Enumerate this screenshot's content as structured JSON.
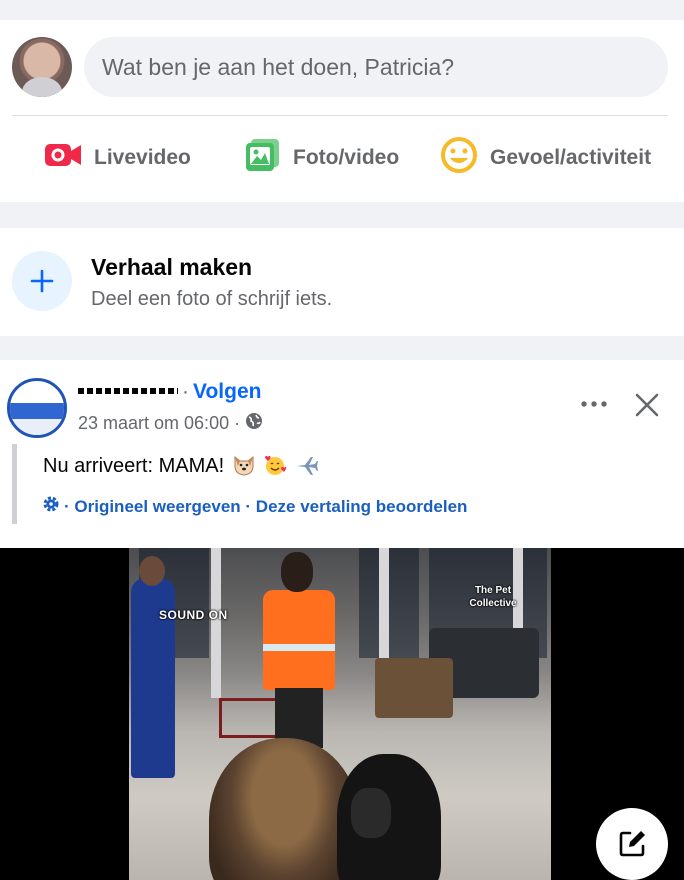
{
  "composer": {
    "placeholder": "Wat ben je aan het doen, Patricia?",
    "actions": [
      {
        "label": "Livevideo",
        "icon": "live-video-icon",
        "color": "#f02849"
      },
      {
        "label": "Foto/video",
        "icon": "photo-icon",
        "color": "#45bd62"
      },
      {
        "label": "Gevoel/activiteit",
        "icon": "feeling-icon",
        "color": "#f7b928"
      }
    ]
  },
  "story": {
    "title": "Verhaal maken",
    "subtitle": "Deel een foto of schrijf iets."
  },
  "post": {
    "author": "Fur Family",
    "follow_label": "Volgen",
    "timestamp": "23 maart om 06:00",
    "audience_icon": "globe-icon",
    "text": "Nu arriveert: MAMA!",
    "emojis": [
      "dog-face",
      "smiling-face-with-hearts",
      "airplane"
    ],
    "translation": {
      "show_original": "Origineel weergeven",
      "rate": "Deze vertaling beoordelen"
    },
    "video": {
      "overlay_text": "SOUND ON",
      "watermark": "The Pet Collective"
    }
  },
  "colors": {
    "accent": "#0866ff",
    "secondary_text": "#65676b",
    "background": "#f0f2f5"
  }
}
